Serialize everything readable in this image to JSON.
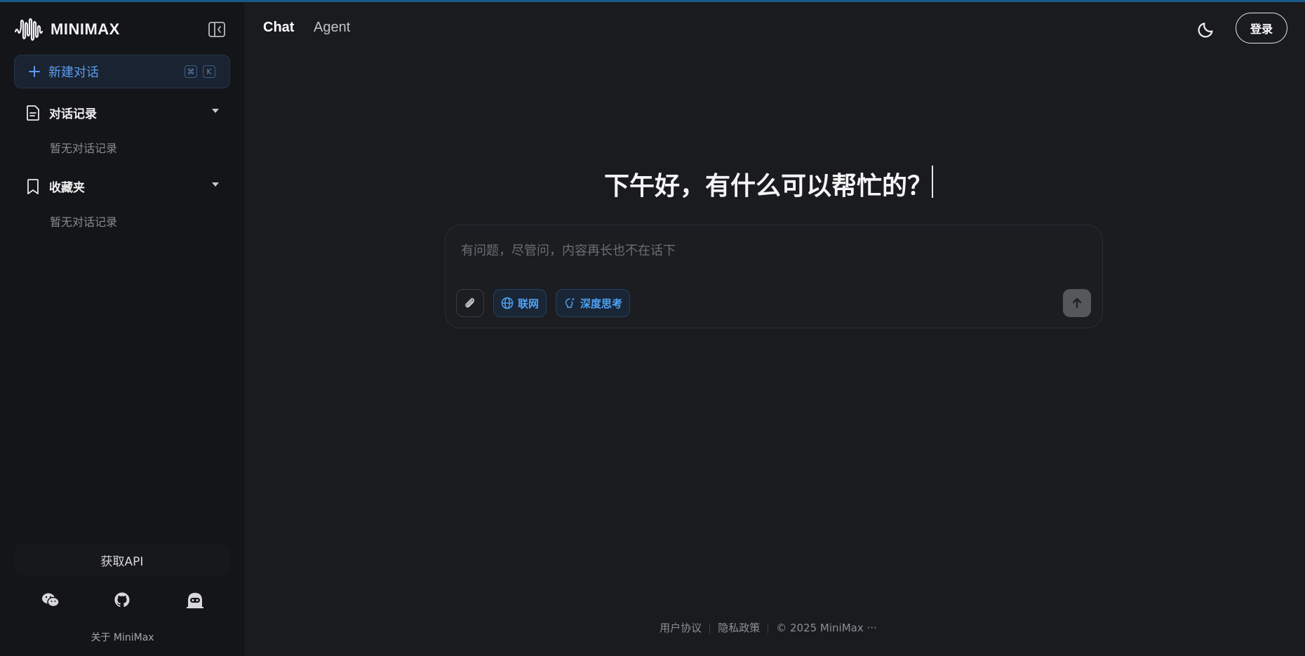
{
  "brand": {
    "name": "MINIMAX",
    "logo_icon": "waveform-logo-icon"
  },
  "sidebar": {
    "collapse_icon": "sidebar-collapse-icon",
    "new_chat": {
      "label": "新建对话",
      "shortcut": [
        "⌘",
        "K"
      ]
    },
    "sections": [
      {
        "title": "对话记录",
        "icon": "document-icon",
        "empty_text": "暂无对话记录"
      },
      {
        "title": "收藏夹",
        "icon": "bookmark-icon",
        "empty_text": "暂无对话记录"
      }
    ],
    "api_button": "获取API",
    "social_icons": [
      "wechat-icon",
      "github-icon",
      "community-icon"
    ],
    "about": "关于 MiniMax"
  },
  "header": {
    "tabs": [
      {
        "label": "Chat",
        "active": true
      },
      {
        "label": "Agent",
        "active": false
      }
    ],
    "theme_icon": "moon-icon",
    "login": "登录"
  },
  "main": {
    "greeting": "下午好，有什么可以帮忙的？",
    "composer": {
      "placeholder": "有问题，尽管问，内容再长也不在话下",
      "web_search": "联网",
      "deep_think": "深度思考"
    }
  },
  "footer": {
    "terms": "用户协议",
    "privacy": "隐私政策",
    "copyright": "© 2025 MiniMax",
    "more": "···"
  },
  "colors": {
    "background": "#1a1b1f",
    "sidebar": "#141519",
    "accent": "#4ea3f5"
  }
}
